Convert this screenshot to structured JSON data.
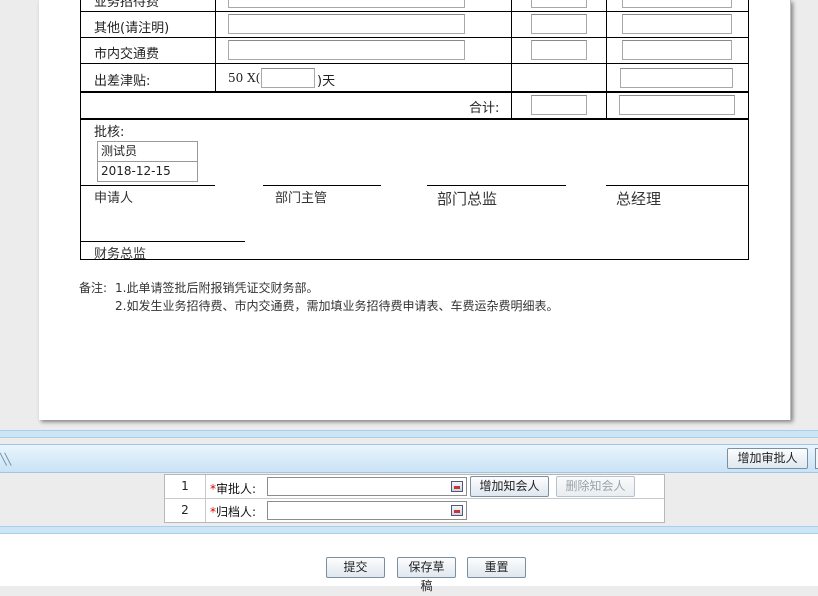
{
  "form": {
    "rows": [
      {
        "label": "业务招待费"
      },
      {
        "label": "其他(请注明)"
      },
      {
        "label": "市内交通费"
      },
      {
        "label": "出差津贴:"
      }
    ],
    "allowance": {
      "prefix": "50 X(",
      "suffix": ")天"
    },
    "total_label": "合计:",
    "approval": {
      "label": "批核:",
      "approver": "测试员",
      "date": "2018-12-15"
    },
    "signatures": {
      "applicant": "申请人",
      "dept_manager": "部门主管",
      "dept_director": "部门总监",
      "general_manager": "总经理",
      "finance_director": "财务总监"
    }
  },
  "remarks": {
    "prefix": "备注:",
    "line1": "1.此单请签批后附报销凭证交财务部。",
    "line2": "2.如发生业务招待费、市内交通费，需加填业务招待费申请表、车费运杂费明细表。"
  },
  "toolbar": {
    "add_approver": "增加审批人"
  },
  "flow": {
    "rows": [
      {
        "num": "1",
        "label": "审批人:"
      },
      {
        "num": "2",
        "label": "归档人:"
      }
    ],
    "add_cc": "增加知会人",
    "remove_cc": "删除知会人"
  },
  "actions": {
    "submit": "提交",
    "save_draft": "保存草稿",
    "reset": "重置"
  }
}
